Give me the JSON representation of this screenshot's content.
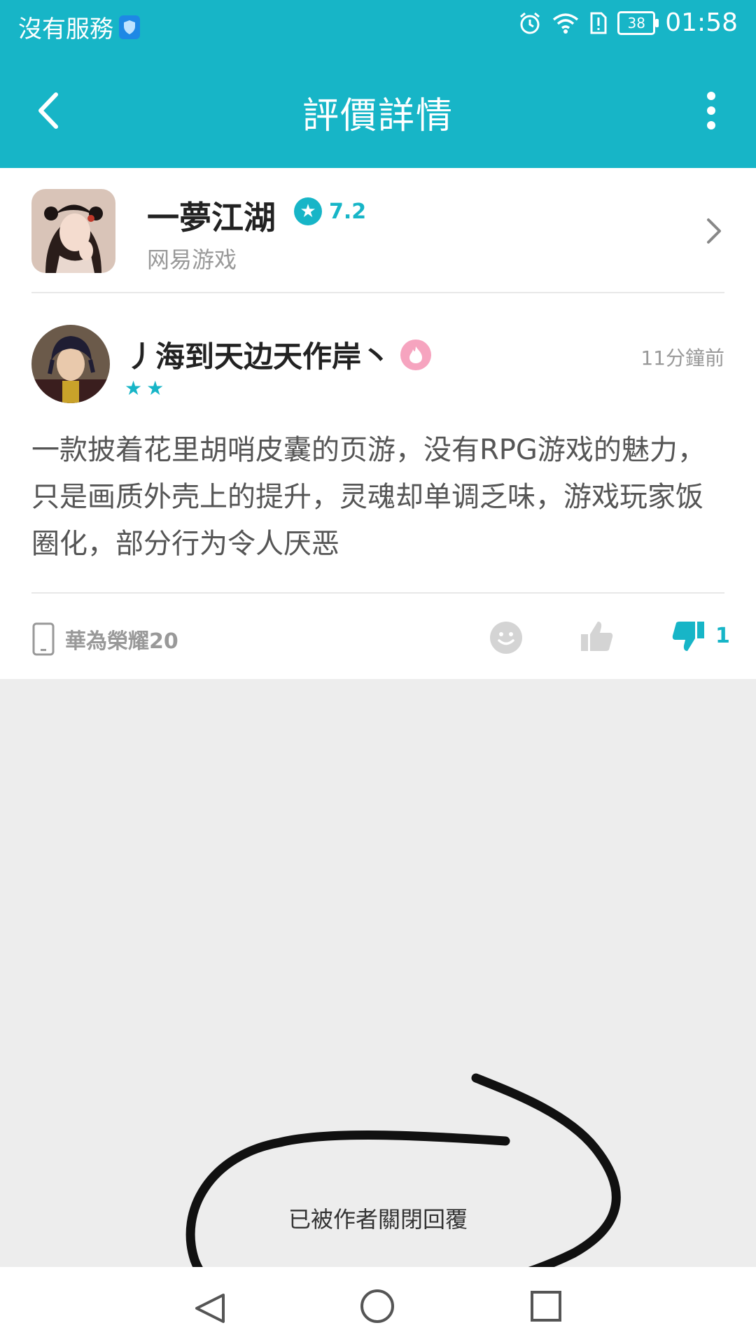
{
  "status_bar": {
    "carrier": "沒有服務",
    "battery": "38",
    "time": "01:58"
  },
  "app_bar": {
    "title": "評價詳情",
    "back_icon": "back-arrow-icon",
    "more_icon": "more-vertical-icon"
  },
  "game": {
    "name": "一夢江湖",
    "rating": "7.2",
    "publisher": "网易游戏"
  },
  "review": {
    "username": "丿海到天边天作岸丶",
    "timestamp": "11分鐘前",
    "stars": "★★",
    "star_count": 2,
    "text": "一款披着花里胡哨皮囊的页游，没有RPG游戏的魅力，只是画质外壳上的提升，灵魂却单调乏味，游戏玩家饭圈化，部分行为令人厌恶",
    "device": "華為榮耀20",
    "dislike_count": "1"
  },
  "replies": {
    "closed_note": "已被作者關閉回覆"
  },
  "colors": {
    "accent": "#17b5c7",
    "background": "#ededed"
  }
}
